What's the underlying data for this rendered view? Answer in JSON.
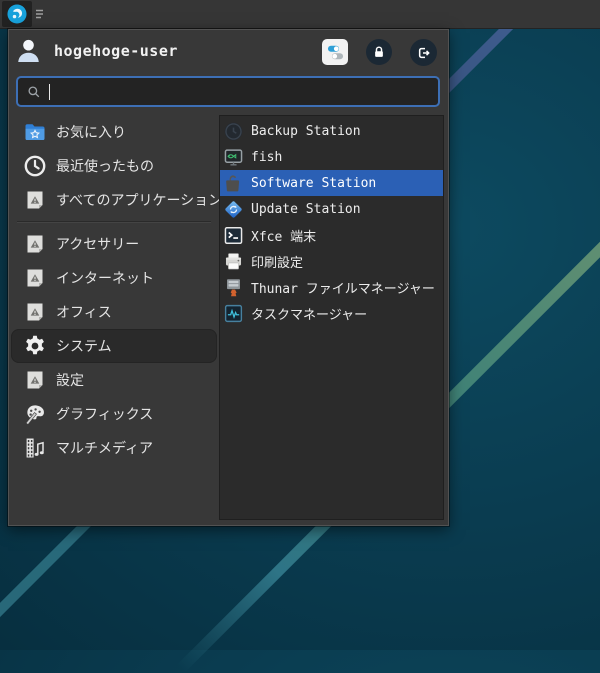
{
  "panel": {
    "logo_icon": "distro-logo-icon",
    "handle_icon": "menu-lines-icon"
  },
  "menu": {
    "header": {
      "username": "hogehoge-user",
      "avatar_icon": "user-icon",
      "buttons": [
        {
          "name": "all-settings-button",
          "icon": "toggles-icon"
        },
        {
          "name": "lock-screen-button",
          "icon": "lock-icon"
        },
        {
          "name": "log-out-button",
          "icon": "logout-icon"
        }
      ]
    },
    "search": {
      "icon": "search-icon",
      "value": "",
      "placeholder": ""
    },
    "category_groups": [
      {
        "items": [
          {
            "label": "お気に入り",
            "icon": "favorites-folder-icon",
            "selected": false
          },
          {
            "label": "最近使ったもの",
            "icon": "clock-icon",
            "selected": false
          },
          {
            "label": "すべてのアプリケーション",
            "icon": "generic-app-icon",
            "selected": false
          }
        ]
      },
      {
        "items": [
          {
            "label": "アクセサリー",
            "icon": "generic-app-icon",
            "selected": false
          },
          {
            "label": "インターネット",
            "icon": "generic-app-icon",
            "selected": false
          },
          {
            "label": "オフィス",
            "icon": "generic-app-icon",
            "selected": false
          },
          {
            "label": "システム",
            "icon": "gear-icon",
            "selected": true
          },
          {
            "label": "設定",
            "icon": "generic-app-icon",
            "selected": false
          },
          {
            "label": "グラフィックス",
            "icon": "graphics-icon",
            "selected": false
          },
          {
            "label": "マルチメディア",
            "icon": "multimedia-icon",
            "selected": false
          }
        ]
      }
    ],
    "apps": [
      {
        "label": "Backup Station",
        "icon": "backup-station-icon",
        "selected": false
      },
      {
        "label": "fish",
        "icon": "fish-terminal-icon",
        "selected": false
      },
      {
        "label": "Software Station",
        "icon": "software-station-icon",
        "selected": true
      },
      {
        "label": "Update Station",
        "icon": "update-station-icon",
        "selected": false
      },
      {
        "label": "Xfce 端末",
        "icon": "terminal-icon",
        "selected": false
      },
      {
        "label": "印刷設定",
        "icon": "printer-icon",
        "selected": false
      },
      {
        "label": "Thunar ファイルマネージャー",
        "icon": "thunar-icon",
        "selected": false
      },
      {
        "label": "タスクマネージャー",
        "icon": "task-manager-icon",
        "selected": false
      }
    ]
  },
  "colors": {
    "selection_blue": "#2b60b5",
    "search_focus_border": "#3d6fb5",
    "menu_background": "#383838",
    "list_background": "#2b2b2b",
    "panel_background": "#363636",
    "desktop_teal": "#0a3c50"
  }
}
